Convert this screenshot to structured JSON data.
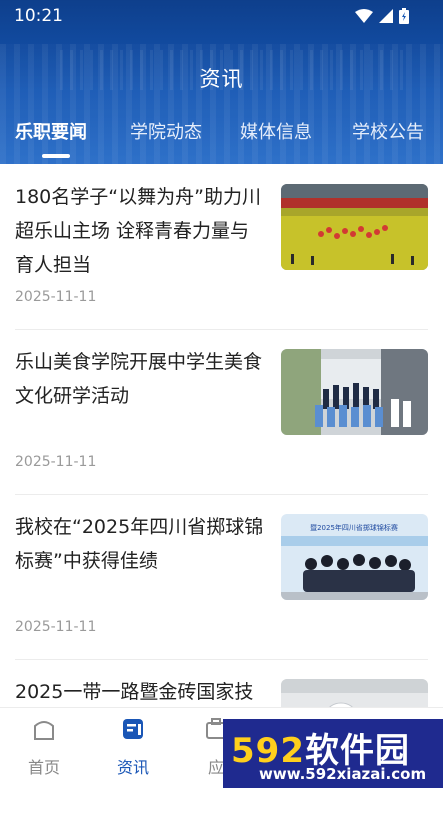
{
  "status_bar": {
    "time": "10:21"
  },
  "header": {
    "title": "资讯",
    "tabs": [
      {
        "label": "乐职要闻",
        "active": true
      },
      {
        "label": "学院动态",
        "active": false
      },
      {
        "label": "媒体信息",
        "active": false
      },
      {
        "label": "学校公告",
        "active": false
      }
    ]
  },
  "news": [
    {
      "title": "180名学子“以舞为舟”助力川超乐山主场  诠释青春力量与育人担当",
      "date": "2025-11-11",
      "thumb": "stadium-photo"
    },
    {
      "title": "乐山美食学院开展中学生美食文化研学活动",
      "date": "2025-11-11",
      "thumb": "group-photo"
    },
    {
      "title": "我校在“2025年四川省掷球锦标赛”中获得佳绩",
      "date": "2025-11-11",
      "thumb": "team-photo",
      "thumb_banner": "暨2025年四川省掷球锦标赛"
    },
    {
      "title": "2025一带一路暨金砖国家技",
      "date": "",
      "thumb": "event-photo"
    }
  ],
  "tabbar": {
    "items": [
      {
        "label": "首页",
        "icon": "home-icon",
        "active": false
      },
      {
        "label": "资讯",
        "icon": "news-icon",
        "active": true
      },
      {
        "label": "应",
        "icon": "apps-icon",
        "active": false
      }
    ]
  },
  "watermark": {
    "brand_prefix": "592",
    "brand_suffix": "软件园",
    "url": "www.592xiazai.com"
  },
  "colors": {
    "primary": "#1a56b6",
    "header_top": "#0e3f8c",
    "text": "#222222",
    "muted": "#9a9a9a"
  }
}
